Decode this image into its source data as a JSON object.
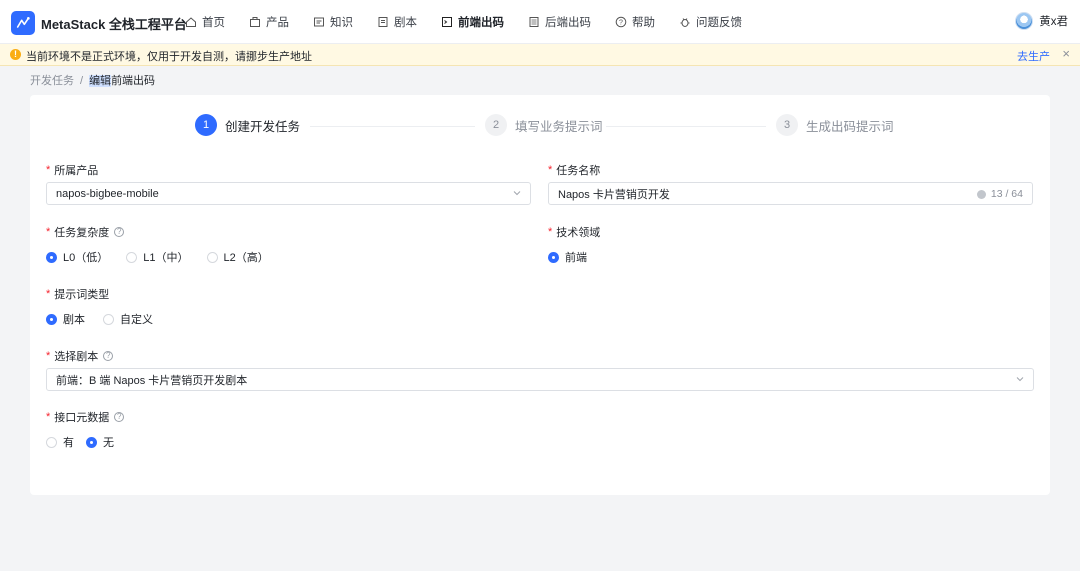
{
  "app": {
    "brand": "MetaStack 全栈工程平台"
  },
  "nav": {
    "items": [
      {
        "label": "首页",
        "icon": "home-icon"
      },
      {
        "label": "产品",
        "icon": "box-icon"
      },
      {
        "label": "知识",
        "icon": "book-icon"
      },
      {
        "label": "剧本",
        "icon": "script-icon"
      },
      {
        "label": "前端出码",
        "icon": "terminal-icon",
        "active": true
      },
      {
        "label": "后端出码",
        "icon": "server-icon"
      },
      {
        "label": "帮助",
        "icon": "help-icon"
      },
      {
        "label": "问题反馈",
        "icon": "bug-icon"
      }
    ]
  },
  "user": {
    "name": "黄x君"
  },
  "warning": {
    "text": "当前环境不是正式环境，仅用于开发自测，请挪步生产地址",
    "link": "去生产"
  },
  "breadcrumb": {
    "root": "开发任务",
    "sep": "/",
    "current_hl": "编辑",
    "current_rest": "前端出码"
  },
  "steps": [
    {
      "num": "1",
      "label": "创建开发任务",
      "active": true
    },
    {
      "num": "2",
      "label": "填写业务提示词"
    },
    {
      "num": "3",
      "label": "生成出码提示词"
    }
  ],
  "form": {
    "product": {
      "label": "所属产品",
      "value": "napos-bigbee-mobile"
    },
    "task_name": {
      "label": "任务名称",
      "value": "Napos 卡片营销页开发",
      "counter": "13 / 64"
    },
    "complexity": {
      "label": "任务复杂度",
      "options": [
        "L0（低）",
        "L1（中）",
        "L2（高）"
      ],
      "selected": 0
    },
    "tech_domain": {
      "label": "技术领域",
      "options": [
        "前端"
      ],
      "selected": 0
    },
    "prompt_type": {
      "label": "提示词类型",
      "options": [
        "剧本",
        "自定义"
      ],
      "selected": 0
    },
    "script": {
      "label": "选择剧本",
      "value": "前端：B 端 Napos 卡片营销页开发剧本"
    },
    "api_meta": {
      "label": "接口元数据",
      "options": [
        "有",
        "无"
      ],
      "selected": 1
    }
  },
  "colors": {
    "accent": "#2f6bff",
    "warning_bg": "#fff9e3",
    "warning_icon": "#faad14",
    "required": "#f5222d"
  }
}
